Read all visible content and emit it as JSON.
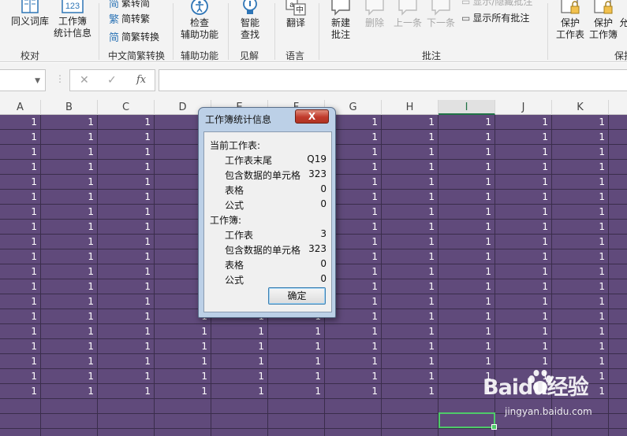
{
  "ribbon": {
    "buttons": {
      "thesaurus": "同义词库",
      "workbook_stats": "工作簿\n统计信息",
      "check_accessibility": "检查\n辅助功能",
      "smart_lookup": "智能\n查找",
      "translate": "翻译",
      "new_comment": "新建\n批注",
      "delete": "删除",
      "previous": "上一条",
      "next": "下一条",
      "protect_sheet": "保护\n工作表",
      "protect_workbook": "保护\n工作簿"
    },
    "workbook_stats_badge": "123",
    "chinese_conversion": {
      "to_simplified": "繁转简",
      "to_traditional": "简转繁",
      "convert": "简繁转换"
    },
    "comments": {
      "show_hide_comment": "显示/隐藏批注",
      "show_all_comments": "显示所有批注"
    },
    "groups": {
      "proofing": "校对",
      "chinese_conversion": "中文简繁转换",
      "accessibility": "辅助功能",
      "insights": "见解",
      "language": "语言",
      "comments": "批注",
      "protect": "保护"
    },
    "cut_off_label": "允"
  },
  "formula_bar": {
    "name_box": "",
    "cancel_icon": "✕",
    "enter_icon": "✓",
    "fx_label": "fx",
    "formula": ""
  },
  "sheet": {
    "columns": [
      "A",
      "B",
      "C",
      "D",
      "E",
      "F",
      "G",
      "H",
      "I",
      "J",
      "K"
    ],
    "selected_column": "I",
    "cell_value": "1",
    "fill_color": "#604a7b"
  },
  "dialog": {
    "title": "工作簿统计信息",
    "close_label": "X",
    "sheet_section": "当前工作表:",
    "sheet_rows": [
      {
        "label": "工作表末尾",
        "value": "Q19"
      },
      {
        "label": "包含数据的单元格",
        "value": "323"
      },
      {
        "label": "表格",
        "value": "0"
      },
      {
        "label": "公式",
        "value": "0"
      }
    ],
    "workbook_section": "工作簿:",
    "workbook_rows": [
      {
        "label": "工作表",
        "value": "3"
      },
      {
        "label": "包含数据的单元格",
        "value": "323"
      },
      {
        "label": "表格",
        "value": "0"
      },
      {
        "label": "公式",
        "value": "0"
      }
    ],
    "ok_label": "确定"
  },
  "watermark": {
    "brand": "Baidu经验",
    "url": "jingyan.baidu.com"
  }
}
